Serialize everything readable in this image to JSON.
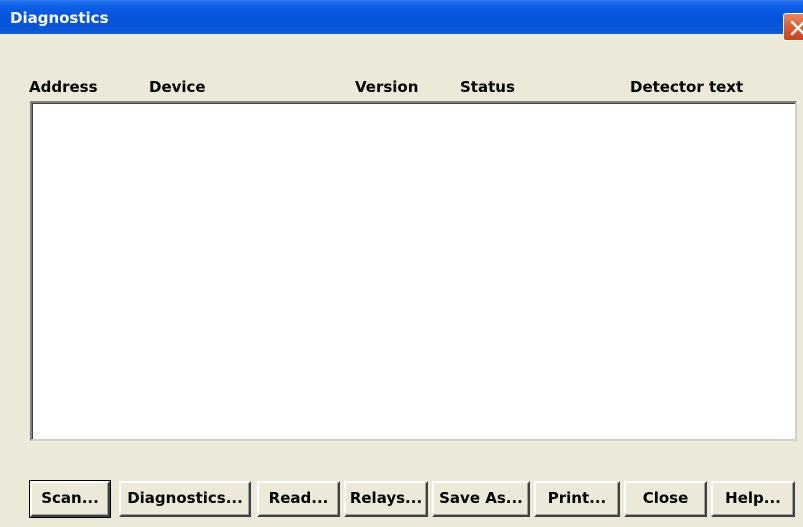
{
  "window": {
    "title": "Diagnostics",
    "colors": {
      "titlebar": "#0554dc",
      "face": "#ece9d8",
      "close": "#d8542a"
    }
  },
  "list": {
    "columns": [
      "Address",
      "Device",
      "Version",
      "Status",
      "Detector text"
    ],
    "rows": []
  },
  "buttons": {
    "scan": "Scan...",
    "diagnostics": "Diagnostics...",
    "read": "Read...",
    "relays": "Relays...",
    "save_as": "Save As...",
    "print": "Print...",
    "close": "Close",
    "help": "Help..."
  },
  "icons": {
    "close": "close-icon"
  }
}
